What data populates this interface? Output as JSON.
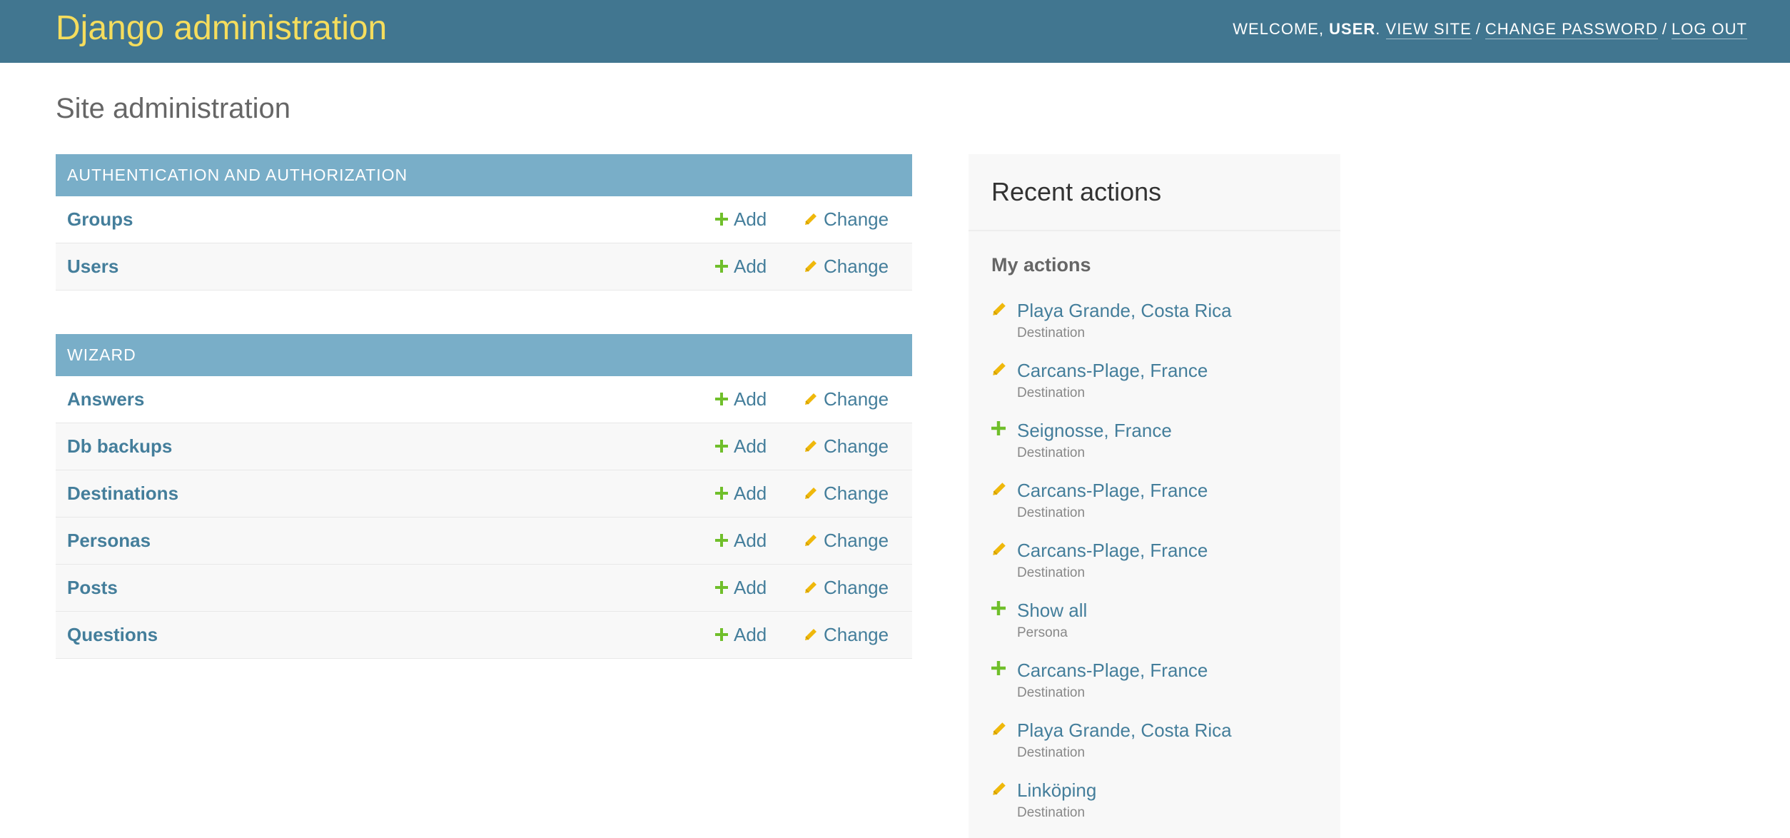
{
  "header": {
    "branding": "Django administration",
    "welcome": "WELCOME, ",
    "username": "USER",
    "period": ". ",
    "view_site": "VIEW SITE",
    "change_password": "CHANGE PASSWORD",
    "log_out": "LOG OUT",
    "separator": "/"
  },
  "page_title": "Site administration",
  "modules": [
    {
      "caption": "AUTHENTICATION AND AUTHORIZATION",
      "rows": [
        {
          "name": "Groups",
          "add": "Add",
          "change": "Change"
        },
        {
          "name": "Users",
          "add": "Add",
          "change": "Change"
        }
      ]
    },
    {
      "caption": "WIZARD",
      "rows": [
        {
          "name": "Answers",
          "add": "Add",
          "change": "Change"
        },
        {
          "name": "Db backups",
          "add": "Add",
          "change": "Change"
        },
        {
          "name": "Destinations",
          "add": "Add",
          "change": "Change"
        },
        {
          "name": "Personas",
          "add": "Add",
          "change": "Change"
        },
        {
          "name": "Posts",
          "add": "Add",
          "change": "Change"
        },
        {
          "name": "Questions",
          "add": "Add",
          "change": "Change"
        }
      ]
    }
  ],
  "recent": {
    "title": "Recent actions",
    "subtitle": "My actions",
    "items": [
      {
        "icon": "pencil-icon",
        "label": "Playa Grande, Costa Rica",
        "type": "Destination"
      },
      {
        "icon": "pencil-icon",
        "label": "Carcans-Plage, France",
        "type": "Destination"
      },
      {
        "icon": "plus-icon",
        "label": "Seignosse, France",
        "type": "Destination"
      },
      {
        "icon": "pencil-icon",
        "label": "Carcans-Plage, France",
        "type": "Destination"
      },
      {
        "icon": "pencil-icon",
        "label": "Carcans-Plage, France",
        "type": "Destination"
      },
      {
        "icon": "plus-icon",
        "label": "Show all",
        "type": "Persona"
      },
      {
        "icon": "plus-icon",
        "label": "Carcans-Plage, France",
        "type": "Destination"
      },
      {
        "icon": "pencil-icon",
        "label": "Playa Grande, Costa Rica",
        "type": "Destination"
      },
      {
        "icon": "pencil-icon",
        "label": "Linköping",
        "type": "Destination"
      }
    ]
  },
  "colors": {
    "header_bg": "#417690",
    "branding": "#f5dd5d",
    "caption_bg": "#79aec8",
    "link": "#447e9b",
    "add_icon": "#70bf2b",
    "change_icon": "#efb80b"
  }
}
